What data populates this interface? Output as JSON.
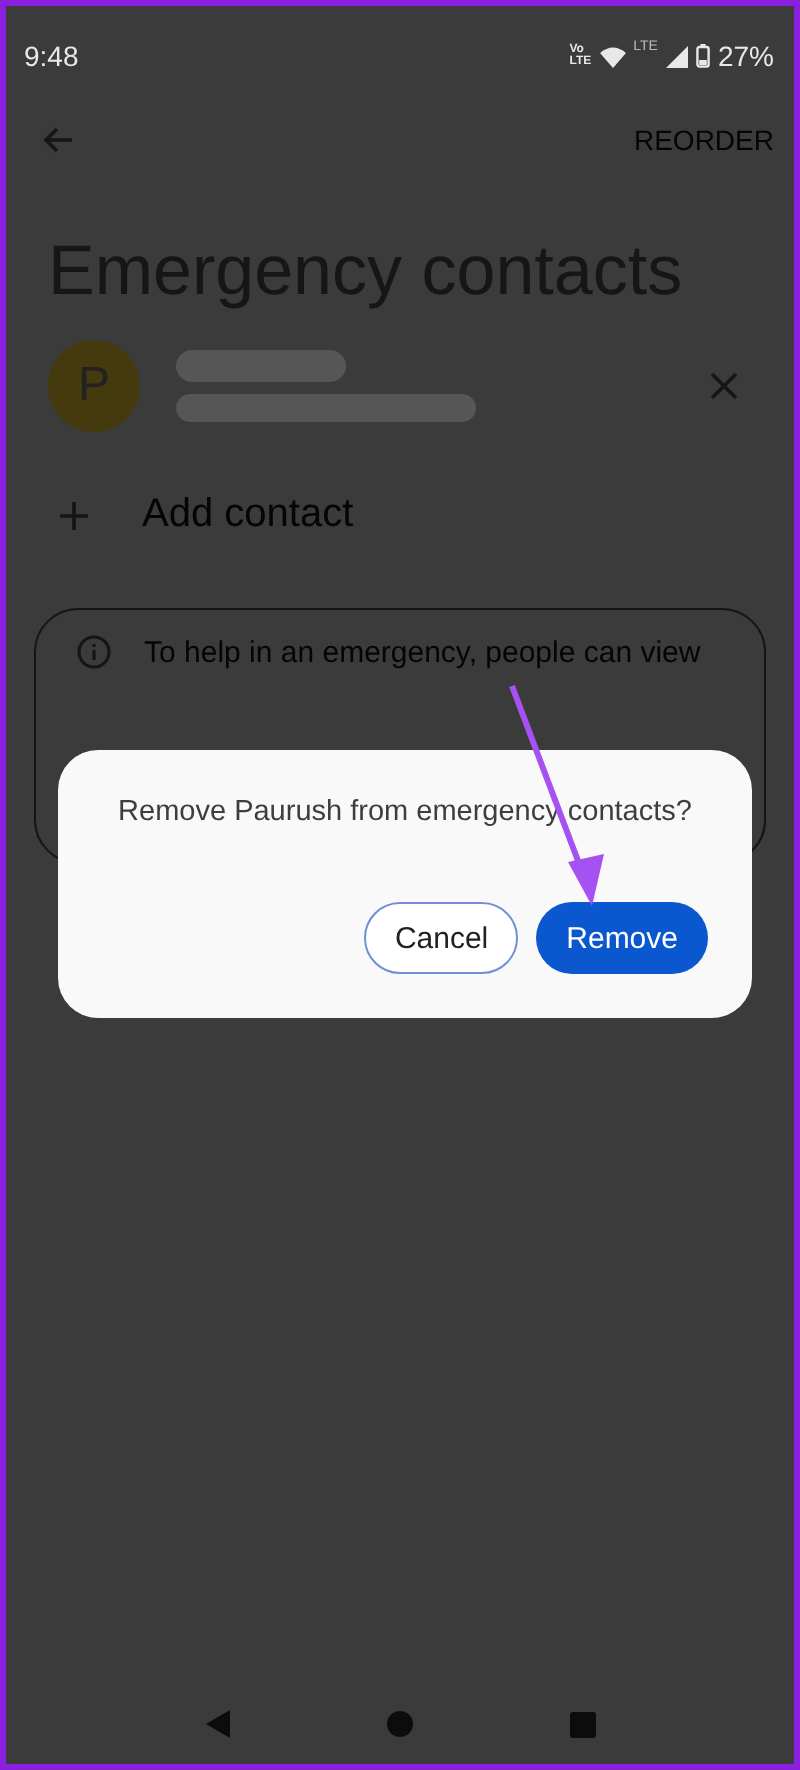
{
  "status_bar": {
    "time": "9:48",
    "volte_lines": [
      "Vo",
      "LTE"
    ],
    "network": "LTE",
    "battery": "27%"
  },
  "toolbar": {
    "action": "REORDER"
  },
  "title": "Emergency contacts",
  "contact": {
    "initial": "P"
  },
  "add_contact": {
    "label": "Add contact"
  },
  "info_card": {
    "text": "To help in an emergency, people can view"
  },
  "dialog": {
    "message": "Remove Paurush from emergency contacts?",
    "buttons": [
      {
        "label": "Cancel",
        "kind": "outlined"
      },
      {
        "label": "Remove",
        "kind": "filled"
      }
    ]
  }
}
